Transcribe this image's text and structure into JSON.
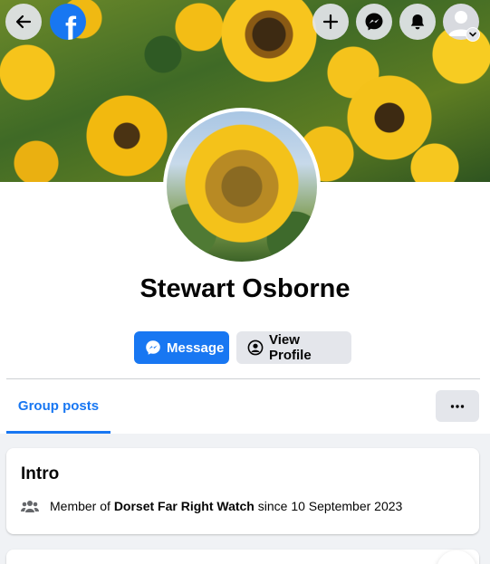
{
  "nav": {
    "logo_letter": "f"
  },
  "profile": {
    "name": "Stewart Osborne"
  },
  "actions": {
    "message_label": "Message",
    "view_profile_label": "View Profile"
  },
  "tabs": [
    {
      "label": "Group posts",
      "active": true
    }
  ],
  "intro": {
    "title": "Intro",
    "member_prefix": "Member of ",
    "group_name": "Dorset Far Right Watch",
    "member_suffix": " since 10 September 2023"
  },
  "colors": {
    "accent": "#1877f2",
    "button_grey": "#e4e6eb",
    "page_bg": "#f0f2f5"
  },
  "icons": {
    "back": "arrow-left-icon",
    "create": "plus-icon",
    "messenger": "messenger-icon",
    "notifications": "bell-icon",
    "account": "avatar-icon",
    "more": "more-dots-icon",
    "members": "people-icon"
  }
}
